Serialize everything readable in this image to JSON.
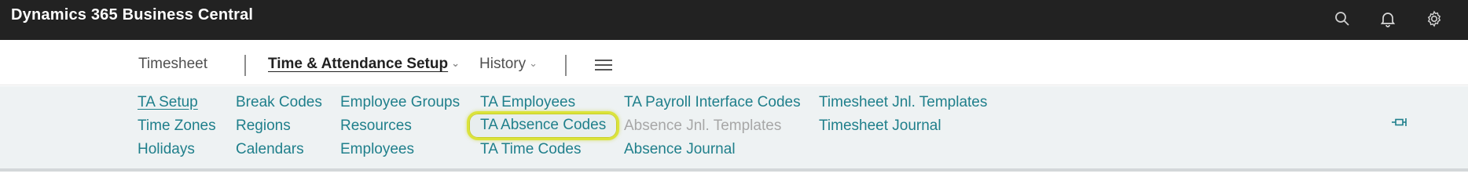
{
  "app": {
    "title": "Dynamics 365 Business Central"
  },
  "topbar": {
    "icons": [
      "search-icon",
      "bell-icon",
      "gear-icon"
    ]
  },
  "nav": {
    "timesheet": "Timesheet",
    "ta_setup": "Time & Attendance Setup",
    "history": "History",
    "menu_icon": "hamburger-menu-icon"
  },
  "subnav": {
    "columns": [
      [
        "TA Setup",
        "Time Zones",
        "Holidays"
      ],
      [
        "Break Codes",
        "Regions",
        "Calendars"
      ],
      [
        "Employee Groups",
        "Resources",
        "Employees"
      ],
      [
        "TA Employees",
        "TA Absence Codes",
        "TA Time Codes"
      ],
      [
        "TA Payroll Interface Codes",
        "Absence Jnl. Templates",
        "Absence Journal"
      ],
      [
        "Timesheet Jnl. Templates",
        "Timesheet Journal"
      ]
    ],
    "highlighted": "TA Absence Codes",
    "disabled": "Absence Jnl. Templates",
    "pin_icon": "pin-icon"
  },
  "colors": {
    "topbar_bg": "#222222",
    "link": "#1f7f8b",
    "highlight_border": "#dbe33a",
    "subnav_bg": "#eef2f3"
  }
}
